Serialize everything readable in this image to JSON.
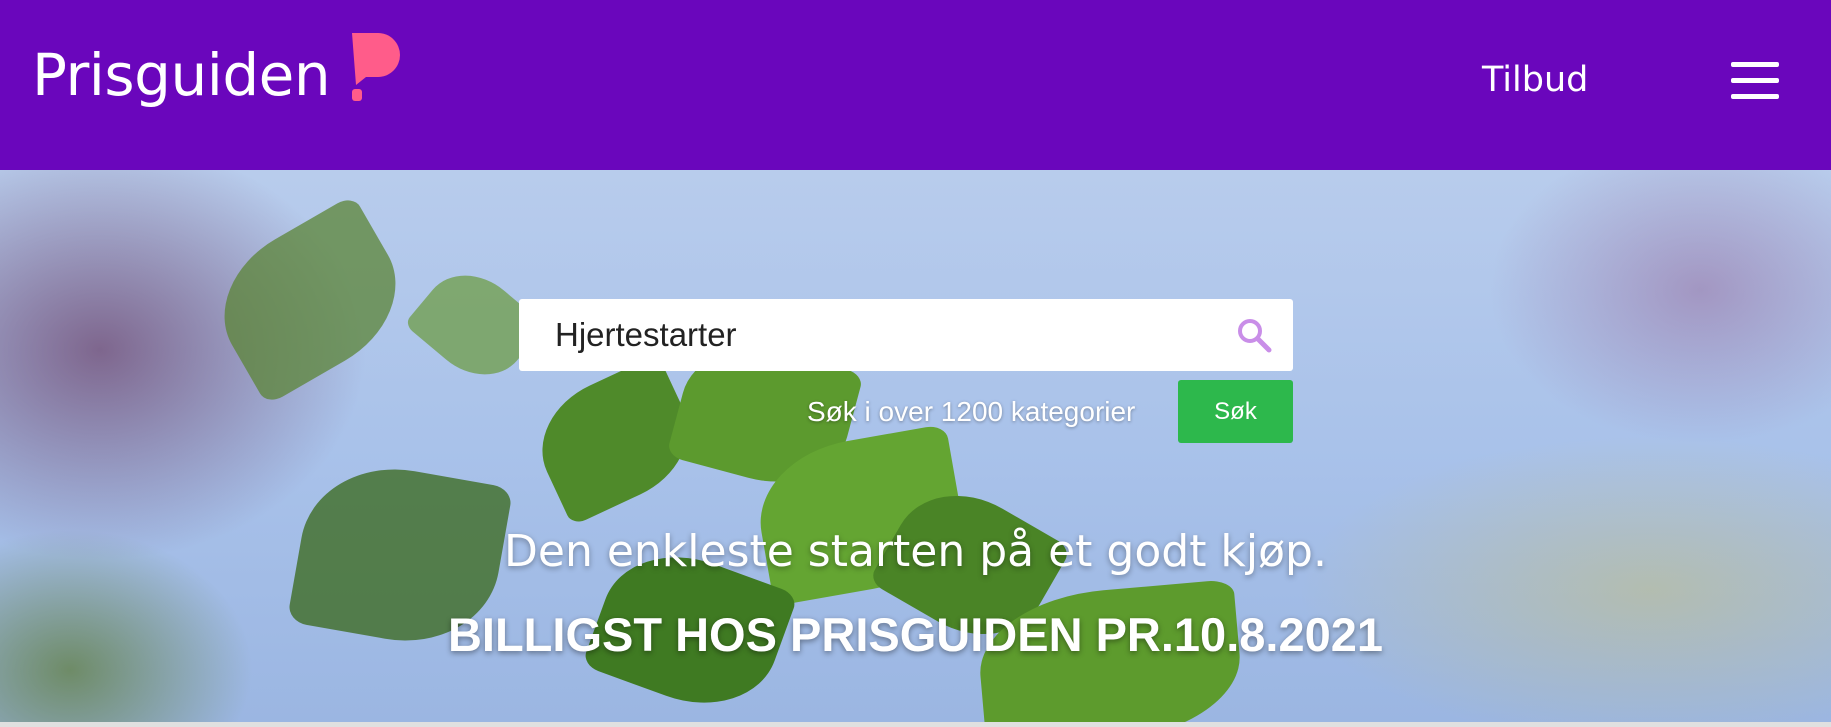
{
  "header": {
    "logo_text": "Prisguiden",
    "logo_color": "#ff5c8a",
    "background": "#6a06bc",
    "nav_link": "Tilbud",
    "menu_icon": "hamburger-menu-icon"
  },
  "search": {
    "value": "Hjertestarter",
    "icon": "search-icon",
    "hint": "Søk i over 1200 kategorier",
    "button_label": "Søk",
    "button_color": "#2db84c"
  },
  "hero": {
    "tagline": "Den enkleste starten på et godt kjøp.",
    "promo": "BILLIGST HOS PRISGUIDEN PR.10.8.2021"
  }
}
